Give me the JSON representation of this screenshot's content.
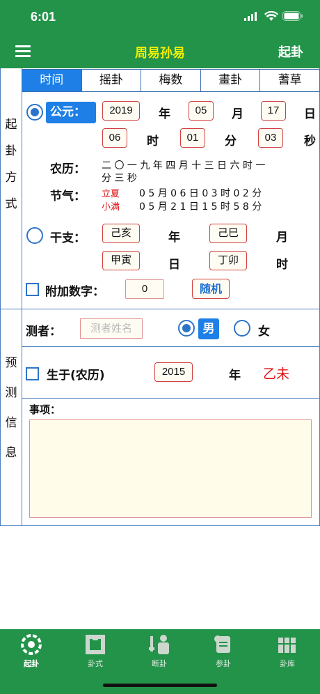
{
  "status": {
    "time": "6:01"
  },
  "nav": {
    "title": "周易孙易",
    "right_button": "起卦"
  },
  "side": {
    "cast_method": [
      "起",
      "卦",
      "方",
      "式"
    ],
    "predict_info": [
      "预",
      "测",
      "信",
      "息"
    ]
  },
  "tabs": [
    "时间",
    "摇卦",
    "梅数",
    "畫卦",
    "蓍草"
  ],
  "gregorian": {
    "label": "公元：",
    "year": "2019",
    "year_unit": "年",
    "month": "05",
    "month_unit": "月",
    "day": "17",
    "day_unit": "日",
    "hour": "06",
    "hour_unit": "时",
    "minute": "01",
    "minute_unit": "分",
    "second": "03",
    "second_unit": "秒"
  },
  "lunar": {
    "label": "农历：",
    "line1": "二 〇 一 九 年 四 月 十 三 日 六 时 一",
    "line2": "分 三 秒"
  },
  "solar_terms": {
    "label": "节气：",
    "rows": [
      {
        "name": "立夏",
        "value": "0 5 月 0 6 日 0 3 时 0 2 分"
      },
      {
        "name": "小满",
        "value": "0 5 月 2 1 日 1 5 时 5 8 分"
      }
    ]
  },
  "ganzhi": {
    "label": "干支：",
    "year": "己亥",
    "year_unit": "年",
    "month": "己巳",
    "month_unit": "月",
    "day": "甲寅",
    "day_unit": "日",
    "hour": "丁卯",
    "hour_unit": "时"
  },
  "extra_number": {
    "label": "附加数字：",
    "value": "0",
    "random_button": "随机"
  },
  "person": {
    "label": "测者：",
    "name_placeholder": "测者姓名",
    "male": "男",
    "female": "女"
  },
  "birth": {
    "label": "生于(农历)",
    "year": "2015",
    "year_unit": "年",
    "ganzhi": "乙未"
  },
  "matter": {
    "label": "事项：",
    "value": ""
  },
  "tabbar": [
    "起卦",
    "卦式",
    "断卦",
    "参卦",
    "卦库"
  ],
  "colors": {
    "green": "#23934a",
    "title_yellow": "#f0f000",
    "accent_blue": "#1e80e6",
    "red": "#e01010"
  }
}
